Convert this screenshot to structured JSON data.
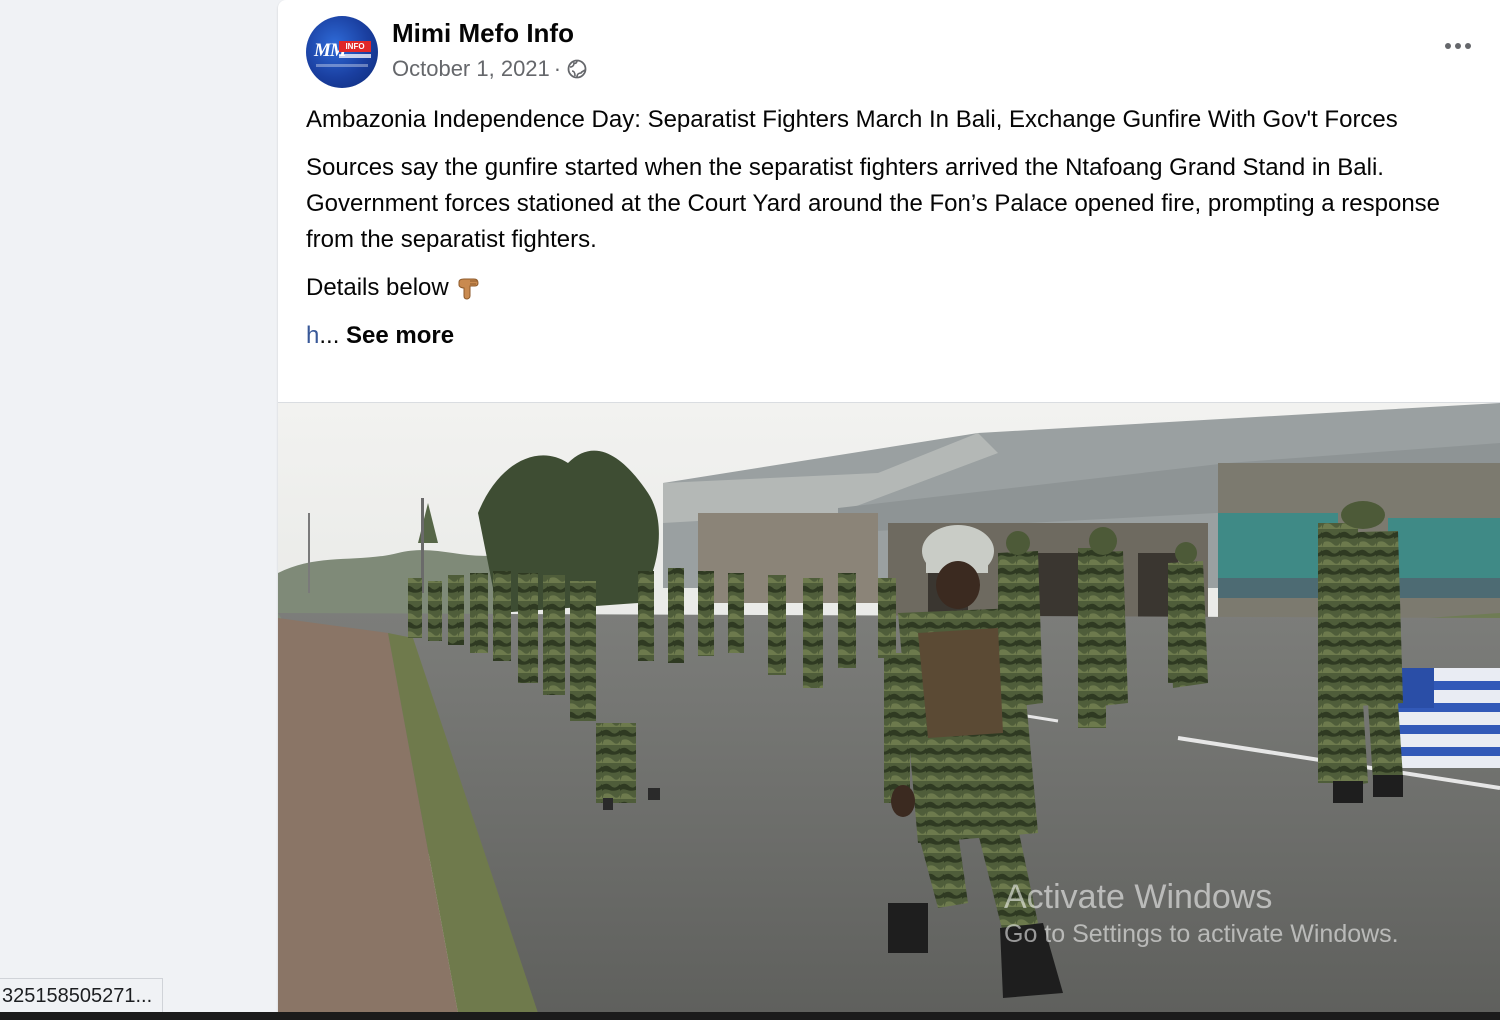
{
  "post": {
    "page_name": "Mimi Mefo Info",
    "date": "October 1, 2021",
    "separator": "·",
    "privacy_icon": "globe-icon",
    "more_icon": "more-options-icon",
    "title": "Ambazonia Independence Day: Separatist Fighters March In Bali, Exchange Gunfire With Gov't Forces",
    "body": "Sources say the gunfire started when the separatist fighters arrived the Ntafoang Grand Stand in Bali. Government forces stationed at the Court Yard around the Fon’s Palace opened fire, prompting a response from the separatist fighters.",
    "details_text": "Details below",
    "details_icon": "backhand-index-pointing-down-icon",
    "link_fragment": "h",
    "ellipsis": "... ",
    "see_more": "See more"
  },
  "avatar": {
    "logo_text": "MM",
    "logo_badge": "INFO"
  },
  "media": {
    "type": "photo",
    "description_icon": "post-photo"
  },
  "watermark": {
    "title": "Activate Windows",
    "subtitle": "Go to Settings to activate Windows."
  },
  "status_bar": {
    "url": "325158505271..."
  },
  "colors": {
    "background": "#f0f2f5",
    "card": "#ffffff",
    "text_primary": "#050505",
    "text_secondary": "#65676b",
    "link": "#385898"
  }
}
